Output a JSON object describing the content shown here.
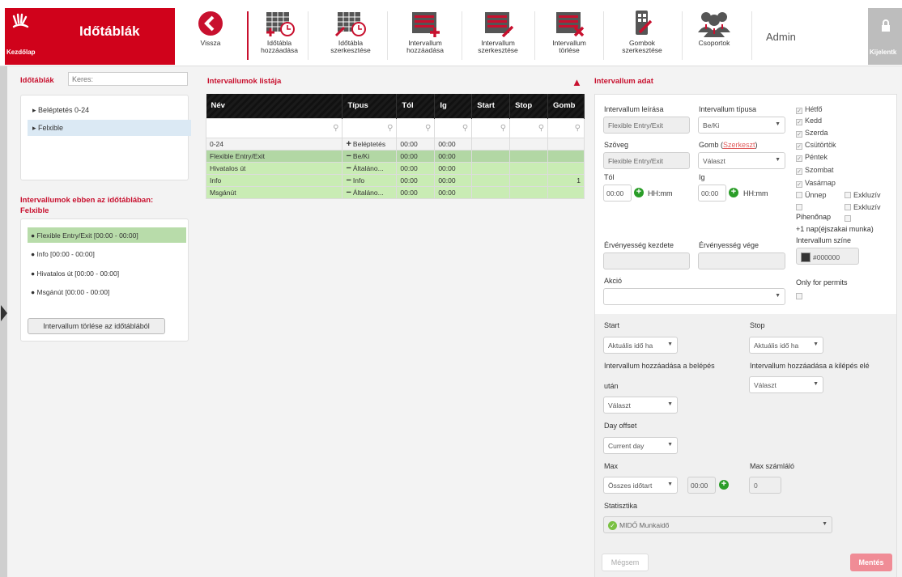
{
  "brand": {
    "title": "Időtáblák",
    "home_label": "Kezdőlap"
  },
  "toolbar": {
    "back": "Vissza",
    "add_table": [
      "Időtábla",
      "hozzáadása"
    ],
    "edit_table": [
      "Időtábla",
      "szerkesztése"
    ],
    "add_interval": [
      "Intervallum",
      "hozzáadása"
    ],
    "edit_interval": [
      "Intervallum",
      "szerkesztése"
    ],
    "delete_interval": [
      "Intervallum",
      "törlése"
    ],
    "edit_buttons": [
      "Gombok",
      "szerkesztése"
    ],
    "groups": "Csoportok",
    "admin": "Admin",
    "logout": "Kijelentk"
  },
  "left": {
    "header": "Időtáblák",
    "search_placeholder": "Keres:",
    "tree": [
      "Beléptetés 0-24",
      "Felxible"
    ],
    "intervals_header": "Intervallumok ebben az időtáblában:",
    "intervals_table": "Felxible",
    "intervals": [
      "Flexible Entry/Exit [00:00 - 00:00]",
      "Info [00:00 - 00:00]",
      "Hivatalos út [00:00 - 00:00]",
      "Msgánút [00:00 - 00:00]"
    ],
    "remove_button": "Intervallum törlése az időtáblából"
  },
  "middle": {
    "header": "Intervallumok listája",
    "columns": [
      "Név",
      "Típus",
      "Tól",
      "Ig",
      "Start",
      "Stop",
      "Gomb"
    ],
    "rows": [
      {
        "name": "0-24",
        "sign": "+",
        "type": "Beléptetés",
        "from": "00:00",
        "to": "00:00",
        "start": "",
        "stop": "",
        "button": ""
      },
      {
        "name": "Flexible Entry/Exit",
        "sign": "−",
        "type": "Be/Ki",
        "from": "00:00",
        "to": "00:00",
        "start": "",
        "stop": "",
        "button": ""
      },
      {
        "name": "Hivatalos út",
        "sign": "−",
        "type": "Általáno...",
        "from": "00:00",
        "to": "00:00",
        "start": "",
        "stop": "",
        "button": ""
      },
      {
        "name": "Info",
        "sign": "−",
        "type": "Info",
        "from": "00:00",
        "to": "00:00",
        "start": "",
        "stop": "",
        "button": "1"
      },
      {
        "name": "Msgánút",
        "sign": "−",
        "type": "Általáno...",
        "from": "00:00",
        "to": "00:00",
        "start": "",
        "stop": "",
        "button": ""
      }
    ]
  },
  "right": {
    "header": "Intervallum adat",
    "desc_label": "Intervallum leírása",
    "desc_value": "Flexible Entry/Exit",
    "type_label": "Intervallum típusa",
    "type_value": "Be/Ki",
    "text_label": "Szöveg",
    "text_value": "Flexible Entry/Exit",
    "button_label": "Gomb (",
    "button_edit": "Szerkeszt",
    "button_label_end": ")",
    "button_value": "Választ",
    "from_label": "Tól",
    "from_value": "00:00",
    "to_label": "Ig",
    "to_value": "00:00",
    "time_fmt": "HH:mm",
    "valid_from": "Érvényesség kezdete",
    "valid_to": "Érvényesség vége",
    "color_label": "Intervallum színe",
    "color_value": "#000000",
    "action_label": "Akció",
    "only_permits": "Only for permits",
    "days": [
      "Hétfő",
      "Kedd",
      "Szerda",
      "Csütörtök",
      "Péntek",
      "Szombat",
      "Vasárnap"
    ],
    "holiday": "Ünnep",
    "rest_day": "Pihenőnap",
    "exclusive": "Exkluzív",
    "next_day": "+1 nap(éjszakai munka)",
    "start_label": "Start",
    "start_value": "Aktuális idő ha",
    "stop_label": "Stop",
    "stop_value": "Aktuális idő ha",
    "add_after_entry": "Intervallum hozzáadása a belépés",
    "add_after_entry2": "után",
    "add_after_entry_value": "Választ",
    "add_before_exit": "Intervallum hozzáadása a kilépés elé",
    "add_before_exit_value": "Választ",
    "day_offset_label": "Day offset",
    "day_offset_value": "Current day",
    "max_label": "Max",
    "max_value": "Összes időtart",
    "max_time": "00:00",
    "max_counter_label": "Max számláló",
    "max_counter_value": "0",
    "stats_label": "Statisztika",
    "stats_value": "MIDŐ Munkaidő",
    "cancel": "Mégsem",
    "save": "Mentés"
  }
}
